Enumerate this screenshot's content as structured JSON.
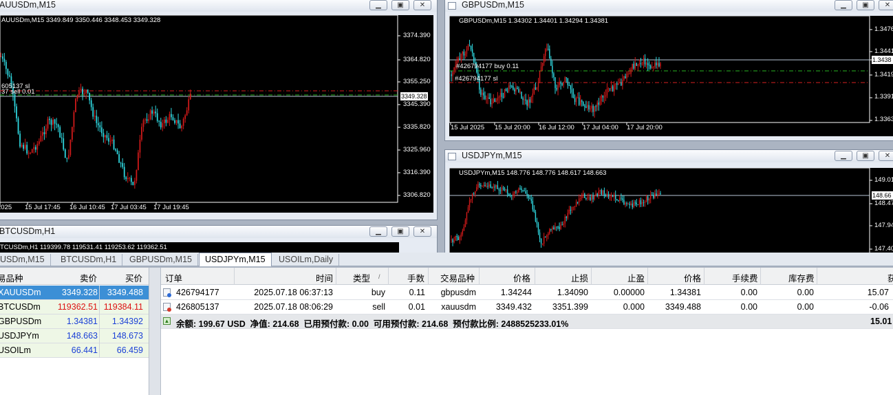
{
  "colors": {
    "bull": "#d11a1a",
    "bear": "#2fd7df",
    "grid": "#7a7a7a",
    "buy_line": "#27b51f",
    "sl_line": "#d81f1f",
    "price_line": "#b7c6d6"
  },
  "windows": {
    "xau": {
      "title": "AUUSDm,M15",
      "ohlc": "AUUSDm,M15  3349.849 3350.446 3348.453 3349.328",
      "trade_label_a": "605137 sl",
      "trade_label_b": "37 sell 0.01",
      "price_box": "3349.328",
      "prices": [
        "3374.390",
        "3364.820",
        "3355.250",
        "3345.390",
        "3335.820",
        "3325.960",
        "3316.390",
        "3306.820"
      ],
      "times": [
        "2025",
        "15 Jul 17:45",
        "16 Jul 10:45",
        "17 Jul 03:45",
        "17 Jul 19:45"
      ],
      "btn_min": "▁",
      "btn_max": "▣",
      "btn_close": "✕"
    },
    "gbp": {
      "title": "GBPUSDm,M15",
      "ohlc": "GBPUSDm,M15  1.34302 1.34401 1.34294 1.34381",
      "trade_label_a": "#426794177 buy 0.11",
      "trade_label_b": "#426794177 sl",
      "price_box": "1.3438",
      "prices": [
        "1.3476",
        "1.3441",
        "1.3419",
        "1.3391",
        "1.3363"
      ],
      "times": [
        "15 Jul 2025",
        "15 Jul 20:00",
        "16 Jul 12:00",
        "17 Jul 04:00",
        "17 Jul 20:00"
      ],
      "btn_min": "▁",
      "btn_max": "▣",
      "btn_close": "✕"
    },
    "btc": {
      "title": "BTCUSDm,H1",
      "ohlc": "TCUSDm,H1  119399.78 119531.41 119253.62 119362.51",
      "btn_min": "▁",
      "btn_max": "▣",
      "btn_close": "✕"
    },
    "jpy": {
      "title": "USDJPYm,M15",
      "ohlc": "USDJPYm,M15  148.776 148.776 148.617 148.663",
      "price_box": "148.66",
      "prices": [
        "149.01",
        "148.47",
        "147.94",
        "147.40"
      ],
      "btn_min": "▁",
      "btn_max": "▣",
      "btn_close": "✕"
    }
  },
  "chart_tabs": [
    {
      "label": "USDm,M15"
    },
    {
      "label": "BTCUSDm,H1"
    },
    {
      "label": "GBPUSDm,M15"
    },
    {
      "label": "USDJPYm,M15"
    },
    {
      "label": "USOILm,Daily"
    }
  ],
  "market_watch": {
    "headers": {
      "symbol": "易品种",
      "bid": "卖价",
      "ask": "买价"
    },
    "rows": [
      {
        "symbol": "XAUUSDm",
        "bid": "3349.328",
        "ask": "3349.488"
      },
      {
        "symbol": "BTCUSDm",
        "bid": "119362.51",
        "ask": "119384.11"
      },
      {
        "symbol": "GBPUSDm",
        "bid": "1.34381",
        "ask": "1.34392"
      },
      {
        "symbol": "USDJPYm",
        "bid": "148.663",
        "ask": "148.673"
      },
      {
        "symbol": "USOILm",
        "bid": "66.441",
        "ask": "66.459"
      }
    ]
  },
  "trade": {
    "headers": {
      "order": "订单",
      "time": "时间",
      "type": "类型",
      "sort_arrow": "/",
      "volume": "手数",
      "symbol": "交易品种",
      "price": "价格",
      "sl": "止损",
      "tp": "止盈",
      "cur_price": "价格",
      "commission": "手续费",
      "swap": "库存费",
      "profit": "获"
    },
    "rows": [
      {
        "order": "426794177",
        "time": "2025.07.18 06:37:13",
        "type": "buy",
        "volume": "0.11",
        "symbol": "gbpusdm",
        "price": "1.34244",
        "sl": "1.34090",
        "tp": "0.00000",
        "cur_price": "1.34381",
        "commission": "0.00",
        "swap": "0.00",
        "profit": "15.07"
      },
      {
        "order": "426805137",
        "time": "2025.07.18 08:06:29",
        "type": "sell",
        "volume": "0.01",
        "symbol": "xauusdm",
        "price": "3349.432",
        "sl": "3351.399",
        "tp": "0.000",
        "cur_price": "3349.488",
        "commission": "0.00",
        "swap": "0.00",
        "profit": "-0.06"
      }
    ],
    "balance_line": "余额: 199.67 USD  净值: 214.68  已用预付款: 0.00  可用预付款: 214.68  预付款比例: 2488525233.01%",
    "balance_profit": "15.01"
  }
}
